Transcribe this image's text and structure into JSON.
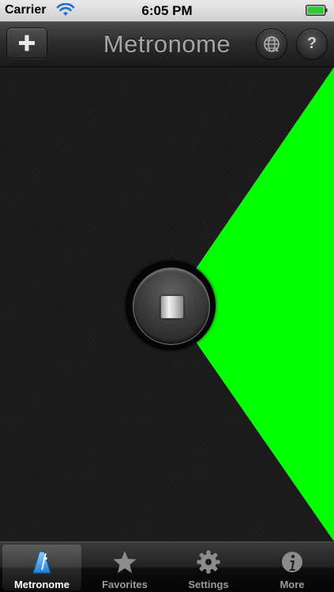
{
  "status_bar": {
    "carrier": "Carrier",
    "time": "6:05 PM",
    "wifi_icon": "wifi-icon",
    "battery_icon": "battery-full-icon",
    "battery_level": 1.0
  },
  "nav_bar": {
    "title": "Metronome",
    "left_button_icon": "plus-icon",
    "right_buttons": [
      {
        "icon": "globe-icon"
      },
      {
        "icon": "help-icon",
        "glyph": "?"
      }
    ]
  },
  "main": {
    "beat_indicator_color": "#00ff00",
    "background_color": "#1c1c1c",
    "control_button_icon": "stop-icon"
  },
  "tab_bar": {
    "selected_index": 0,
    "tabs": [
      {
        "label": "Metronome",
        "icon": "metronome-icon"
      },
      {
        "label": "Favorites",
        "icon": "star-icon"
      },
      {
        "label": "Settings",
        "icon": "gear-icon"
      },
      {
        "label": "More",
        "icon": "info-icon"
      }
    ]
  }
}
